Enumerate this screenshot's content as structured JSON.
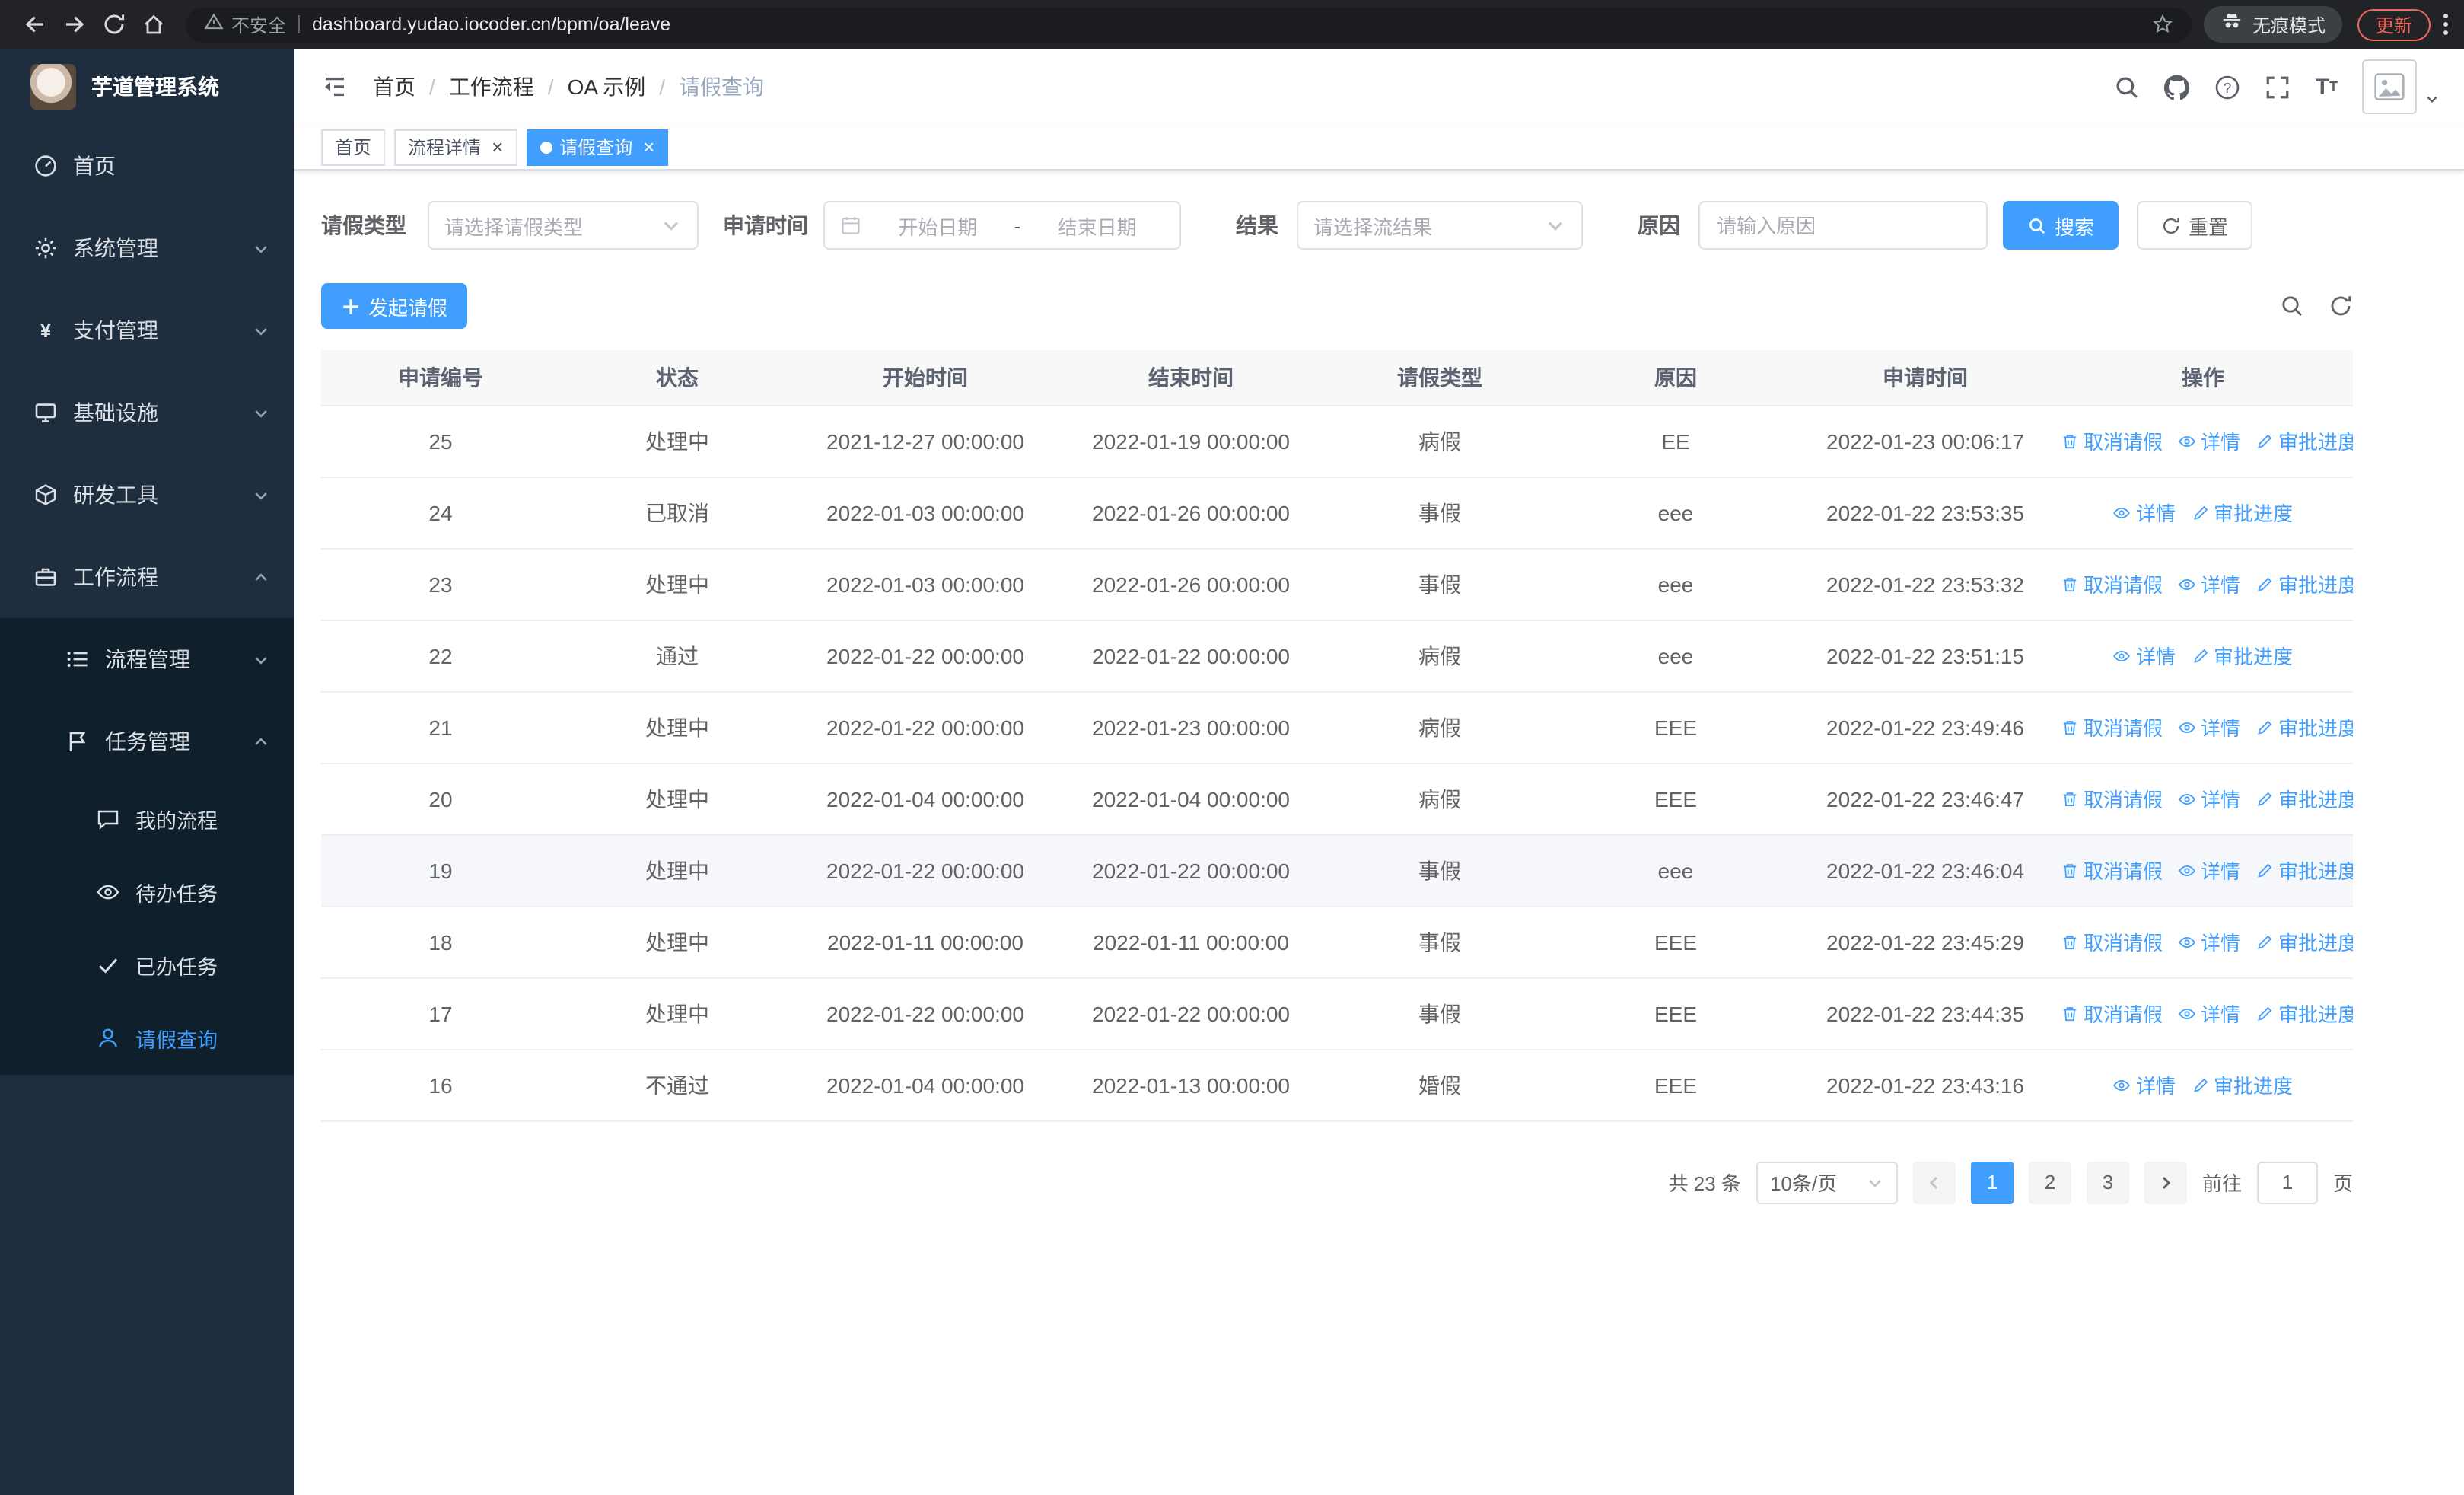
{
  "colors": {
    "primary": "#409EFF",
    "sidebar_bg": "#1F2E3E",
    "submenu_bg": "#101F2C",
    "danger": "#EE675C"
  },
  "browser": {
    "security_label": "不安全",
    "url": "dashboard.yudao.iocoder.cn/bpm/oa/leave",
    "incognito_label": "无痕模式",
    "update_label": "更新"
  },
  "sidebar": {
    "title": "芋道管理系统",
    "menu": [
      {
        "name": "home",
        "label": "首页",
        "icon": "dashboard"
      },
      {
        "name": "system",
        "label": "系统管理",
        "icon": "gear",
        "expandable": true
      },
      {
        "name": "payment",
        "label": "支付管理",
        "icon": "yen",
        "expandable": true
      },
      {
        "name": "infra",
        "label": "基础设施",
        "icon": "infra",
        "expandable": true
      },
      {
        "name": "devtools",
        "label": "研发工具",
        "icon": "tools",
        "expandable": true
      },
      {
        "name": "workflow",
        "label": "工作流程",
        "icon": "briefcase",
        "expandable": true,
        "expanded": true,
        "children": [
          {
            "name": "process-mgmt",
            "label": "流程管理",
            "icon": "flowlist",
            "expandable": true
          },
          {
            "name": "task-mgmt",
            "label": "任务管理",
            "icon": "task",
            "expandable": true,
            "expanded": true,
            "children": [
              {
                "name": "my-process",
                "label": "我的流程",
                "icon": "chat"
              },
              {
                "name": "todo-tasks",
                "label": "待办任务",
                "icon": "eye"
              },
              {
                "name": "done-tasks",
                "label": "已办任务",
                "icon": "check"
              },
              {
                "name": "leave-query",
                "label": "请假查询",
                "icon": "user",
                "active": true
              }
            ]
          }
        ]
      }
    ]
  },
  "header": {
    "breadcrumb": [
      "首页",
      "工作流程",
      "OA 示例",
      "请假查询"
    ]
  },
  "tabs": [
    {
      "label": "首页",
      "closable": false,
      "active": false
    },
    {
      "label": "流程详情",
      "closable": true,
      "active": false
    },
    {
      "label": "请假查询",
      "closable": true,
      "active": true
    }
  ],
  "filters": {
    "type_label": "请假类型",
    "type_placeholder": "请选择请假类型",
    "time_label": "申请时间",
    "date_start_placeholder": "开始日期",
    "date_separator": "-",
    "date_end_placeholder": "结束日期",
    "result_label": "结果",
    "result_placeholder": "请选择流结果",
    "reason_label": "原因",
    "reason_placeholder": "请输入原因",
    "search_label": "搜索",
    "reset_label": "重置"
  },
  "toolbar": {
    "create_label": "发起请假"
  },
  "table": {
    "columns": [
      "申请编号",
      "状态",
      "开始时间",
      "结束时间",
      "请假类型",
      "原因",
      "申请时间",
      "操作"
    ],
    "column_keys": [
      "id",
      "status",
      "start",
      "end",
      "type",
      "reason",
      "applied"
    ],
    "action_labels": {
      "cancel": "取消请假",
      "detail": "详情",
      "progress": "审批进度"
    },
    "rows": [
      {
        "id": "25",
        "status": "处理中",
        "start": "2021-12-27 00:00:00",
        "end": "2022-01-19 00:00:00",
        "type": "病假",
        "reason": "EE",
        "applied": "2022-01-23 00:06:17",
        "actions": [
          "cancel",
          "detail",
          "progress"
        ]
      },
      {
        "id": "24",
        "status": "已取消",
        "start": "2022-01-03 00:00:00",
        "end": "2022-01-26 00:00:00",
        "type": "事假",
        "reason": "eee",
        "applied": "2022-01-22 23:53:35",
        "actions": [
          "detail",
          "progress"
        ]
      },
      {
        "id": "23",
        "status": "处理中",
        "start": "2022-01-03 00:00:00",
        "end": "2022-01-26 00:00:00",
        "type": "事假",
        "reason": "eee",
        "applied": "2022-01-22 23:53:32",
        "actions": [
          "cancel",
          "detail",
          "progress"
        ]
      },
      {
        "id": "22",
        "status": "通过",
        "start": "2022-01-22 00:00:00",
        "end": "2022-01-22 00:00:00",
        "type": "病假",
        "reason": "eee",
        "applied": "2022-01-22 23:51:15",
        "actions": [
          "detail",
          "progress"
        ]
      },
      {
        "id": "21",
        "status": "处理中",
        "start": "2022-01-22 00:00:00",
        "end": "2022-01-23 00:00:00",
        "type": "病假",
        "reason": "EEE",
        "applied": "2022-01-22 23:49:46",
        "actions": [
          "cancel",
          "detail",
          "progress"
        ]
      },
      {
        "id": "20",
        "status": "处理中",
        "start": "2022-01-04 00:00:00",
        "end": "2022-01-04 00:00:00",
        "type": "病假",
        "reason": "EEE",
        "applied": "2022-01-22 23:46:47",
        "actions": [
          "cancel",
          "detail",
          "progress"
        ]
      },
      {
        "id": "19",
        "status": "处理中",
        "start": "2022-01-22 00:00:00",
        "end": "2022-01-22 00:00:00",
        "type": "事假",
        "reason": "eee",
        "applied": "2022-01-22 23:46:04",
        "actions": [
          "cancel",
          "detail",
          "progress"
        ],
        "highlighted": true
      },
      {
        "id": "18",
        "status": "处理中",
        "start": "2022-01-11 00:00:00",
        "end": "2022-01-11 00:00:00",
        "type": "事假",
        "reason": "EEE",
        "applied": "2022-01-22 23:45:29",
        "actions": [
          "cancel",
          "detail",
          "progress"
        ]
      },
      {
        "id": "17",
        "status": "处理中",
        "start": "2022-01-22 00:00:00",
        "end": "2022-01-22 00:00:00",
        "type": "事假",
        "reason": "EEE",
        "applied": "2022-01-22 23:44:35",
        "actions": [
          "cancel",
          "detail",
          "progress"
        ]
      },
      {
        "id": "16",
        "status": "不通过",
        "start": "2022-01-04 00:00:00",
        "end": "2022-01-13 00:00:00",
        "type": "婚假",
        "reason": "EEE",
        "applied": "2022-01-22 23:43:16",
        "actions": [
          "detail",
          "progress"
        ]
      }
    ]
  },
  "pagination": {
    "total": "共 23 条",
    "page_size": "10条/页",
    "pages": [
      "1",
      "2",
      "3"
    ],
    "active_page": "1",
    "goto_label": "前往",
    "goto_value": "1",
    "goto_suffix": "页"
  }
}
